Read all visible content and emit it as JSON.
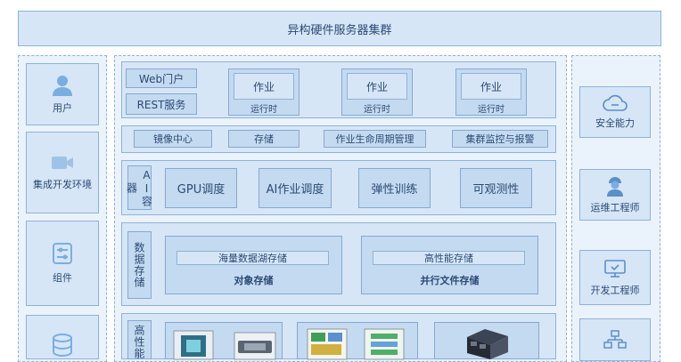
{
  "title": "异构硬件服务器集群",
  "left_sidebar": [
    {
      "label": "用户",
      "icon": "user-icon"
    },
    {
      "label": "集成开发环境",
      "icon": "video-camera-icon"
    },
    {
      "label": "组件",
      "icon": "sliders-icon"
    },
    {
      "label": "",
      "icon": "database-icon"
    }
  ],
  "right_sidebar": [
    {
      "label": "安全能力",
      "icon": "cloud-link-icon"
    },
    {
      "label": "运维工程师",
      "icon": "engineer-icon"
    },
    {
      "label": "开发工程师",
      "icon": "monitor-check-icon"
    },
    {
      "label": "",
      "icon": "network-icon"
    }
  ],
  "portal": {
    "web": "Web门户",
    "rest": "REST服务"
  },
  "jobs": [
    {
      "name": "作业",
      "runtime": "运行时"
    },
    {
      "name": "作业",
      "runtime": "运行时"
    },
    {
      "name": "作业",
      "runtime": "运行时"
    }
  ],
  "services": [
    "镜像中心",
    "存储",
    "作业生命周期管理",
    "集群监控与报警"
  ],
  "ai_container": {
    "label": "AI容器",
    "items": [
      "GPU调度",
      "AI作业调度",
      "弹性训练",
      "可观测性"
    ]
  },
  "data_storage": {
    "label": "数据存储",
    "object": {
      "inner": "海量数据湖存储",
      "title": "对象存储"
    },
    "parallel": {
      "inner": "高性能存储",
      "title": "并行文件存储"
    }
  },
  "hpc": {
    "label": "高性能"
  }
}
